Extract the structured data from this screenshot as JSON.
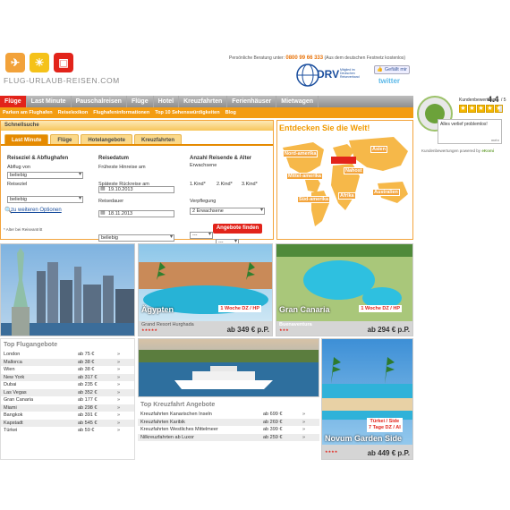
{
  "header": {
    "logo_text": "FLUG-URLAUB-REISEN.COM",
    "phone_prefix": "Persönliche Beratung unter:",
    "phone": "0800 99 66 333",
    "phone_suffix": "(Aus dem deutschen Festnetz kostenlos)",
    "drv_label": "DRV",
    "drv_sub": "Mitglied im Deutschen Reiseverband",
    "facebook": "Gefällt mir",
    "twitter": "twitter"
  },
  "nav": {
    "items": [
      "Flüge",
      "Last Minute",
      "Pauschalreisen",
      "Flüge",
      "Hotel",
      "Kreuzfahrten",
      "Ferienhäuser",
      "Mietwagen"
    ],
    "sub_items": [
      "Parken am Flughafen",
      "Reiselexikon",
      "Flughafeninformationen",
      "Top 10 Sehenswürdigkeiten",
      "Blog"
    ]
  },
  "search": {
    "title": "Schnellsuche",
    "tabs": [
      "Last Minute",
      "Flüge",
      "Hotelangebote",
      "Kreuzfahrten"
    ],
    "col1_title": "Reiseziel & Abflughafen",
    "abflug_label": "Abflug von",
    "abflug_value": "beliebig",
    "ziel_label": "Reiseziel",
    "ziel_value": "beliebig",
    "col2_title": "Reisedatum",
    "hin_label": "Früheste Hinreise am",
    "hin_value": "19.10.2013",
    "rueck_label": "Späteste Rückreise am",
    "rueck_value": "18.11.2013",
    "dauer_label": "Reisedauer",
    "dauer_value": "beliebig",
    "col3_title": "Anzahl Reisende & Alter",
    "erw_label": "Erwachsene",
    "erw_value": "2 Erwachsene",
    "kind1_label": "1.Kind*",
    "kind2_label": "2.Kind*",
    "kind3_label": "3.Kind*",
    "kind_value": "---",
    "verpf_label": "Verpflegung",
    "verpf_value": "egal",
    "more_options": "zu weiteren Optionen",
    "note": "* Alter bei Reiseantritt",
    "find_button": "Angebote finden"
  },
  "map": {
    "title": "Entdecken Sie die Welt!",
    "regions": [
      "Nord-amerika",
      "Asien",
      "Nahost",
      "Mittel-amerika",
      "Süd-amerika",
      "Afrika",
      "Australien"
    ]
  },
  "ekomi": {
    "label": "Kundenbewertung",
    "score": "4.4",
    "of": "/ 5",
    "review": "Alles verlief problemlos!",
    "review_more": "mehr",
    "footer": "Kundenbewertungen powered by",
    "brand": "eKomi"
  },
  "tiles": {
    "egypt": {
      "name": "Ägypten",
      "ribbon": "1 Woche DZ / HP",
      "hotel": "Grand Resort Hurghada",
      "price": "ab 349 € p.P."
    },
    "canaria": {
      "name": "Gran Canaria",
      "ribbon": "1 Woche DZ / HP",
      "hotel": "Buenaventura",
      "price": "ab 294 € p.P."
    },
    "turkey": {
      "ribbon1": "Türkei / Side",
      "ribbon2": "7 Tage DZ / AI",
      "name": "Novum Garden Side",
      "price": "ab 449 € p.P."
    }
  },
  "flights": {
    "title": "Top Flugangebote",
    "rows": [
      {
        "city": "London",
        "price": "ab   75 €",
        "arrow": "»"
      },
      {
        "city": "Mallorca",
        "price": "ab   38 €",
        "arrow": "»"
      },
      {
        "city": "Wien",
        "price": "ab   38 €",
        "arrow": "»"
      },
      {
        "city": "New York",
        "price": "ab 317 €",
        "arrow": "»"
      },
      {
        "city": "Dubai",
        "price": "ab 235 €",
        "arrow": "»"
      },
      {
        "city": "Las Vegas",
        "price": "ab 352 €",
        "arrow": "»"
      },
      {
        "city": "Gran Canaria",
        "price": "ab 177 €",
        "arrow": "»"
      },
      {
        "city": "Miami",
        "price": "ab 298 €",
        "arrow": "»"
      },
      {
        "city": "Bangkok",
        "price": "ab 391 €",
        "arrow": "»"
      },
      {
        "city": "Kapstadt",
        "price": "ab 545 €",
        "arrow": "»"
      },
      {
        "city": "Türkei",
        "price": "ab   59 €",
        "arrow": "»"
      }
    ]
  },
  "cruises": {
    "title": "Top Kreuzfahrt Angebote",
    "rows": [
      {
        "name": "Kreuzfahrten Kanarischen Inseln",
        "price": "ab 699 €",
        "arrow": "»"
      },
      {
        "name": "Kreuzfahrten Karibik",
        "price": "ab 269 €",
        "arrow": "»"
      },
      {
        "name": "Kreuzfahrten Westliches Mittelmeer",
        "price": "ab 399 €",
        "arrow": "»"
      },
      {
        "name": "Nilkreuzfahrten ab Luxor",
        "price": "ab 259 €",
        "arrow": "»"
      }
    ]
  },
  "colors": {
    "orange": "#f39c12",
    "red": "#e2231a",
    "nav_gray": "#9e9e9e"
  }
}
